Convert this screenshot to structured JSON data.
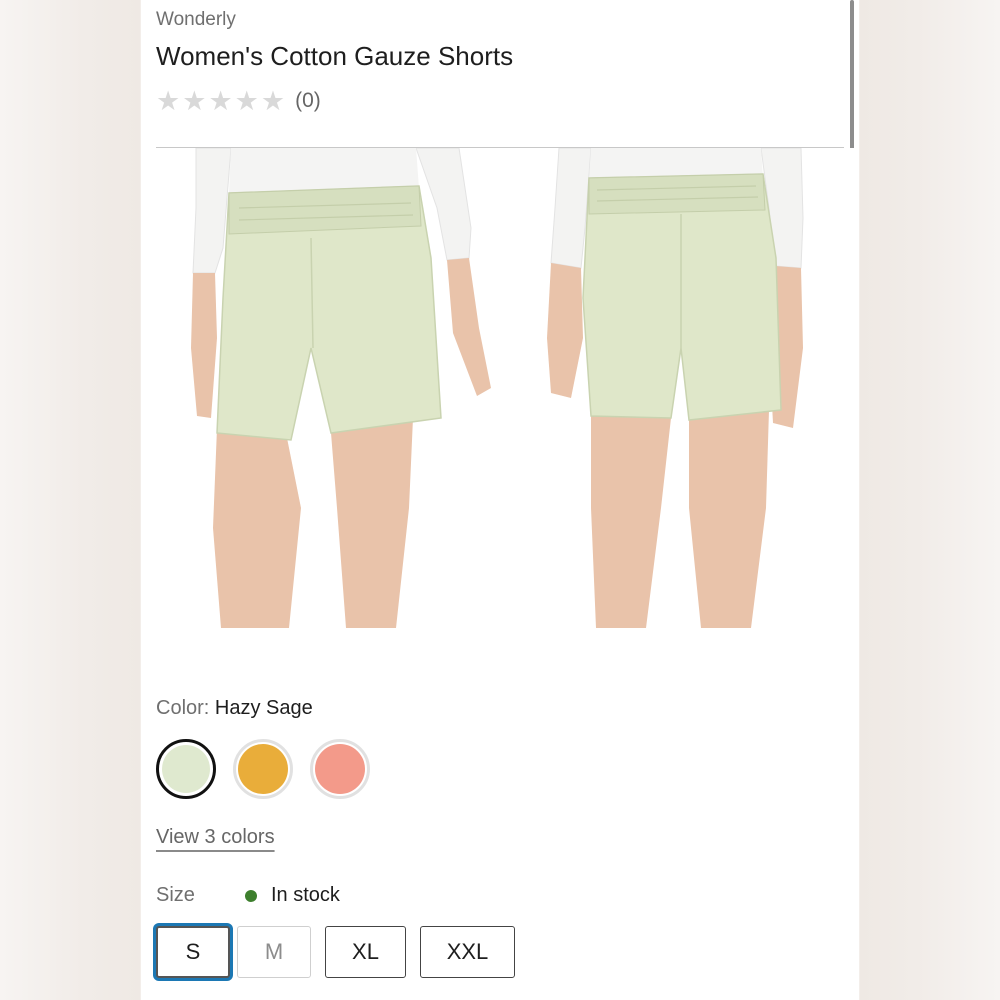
{
  "product": {
    "brand": "Wonderly",
    "title": "Women's Cotton Gauze Shorts",
    "rating": {
      "stars_filled": 0,
      "stars_total": 5,
      "review_count": "(0)"
    }
  },
  "color": {
    "label": "Color:",
    "selected": "Hazy Sage",
    "swatches": [
      {
        "name": "hazy-sage",
        "color": "#dfe9cf",
        "selected": true
      },
      {
        "name": "yellow",
        "color": "#e9ad3a",
        "selected": false
      },
      {
        "name": "coral",
        "color": "#f39a8a",
        "selected": false
      }
    ],
    "view_link": "View 3 colors"
  },
  "size": {
    "label": "Size",
    "stock_text": "In stock",
    "stock_color": "#3d7f2d",
    "options": [
      {
        "label": "S",
        "state": "selected"
      },
      {
        "label": "M",
        "state": "disabled"
      },
      {
        "label": "XL",
        "state": "available"
      },
      {
        "label": "XXL",
        "state": "available"
      }
    ]
  },
  "colors": {
    "shorts": "#dfe7c9",
    "skin": "#e9c3aa",
    "focus_ring": "#1c78b4"
  }
}
